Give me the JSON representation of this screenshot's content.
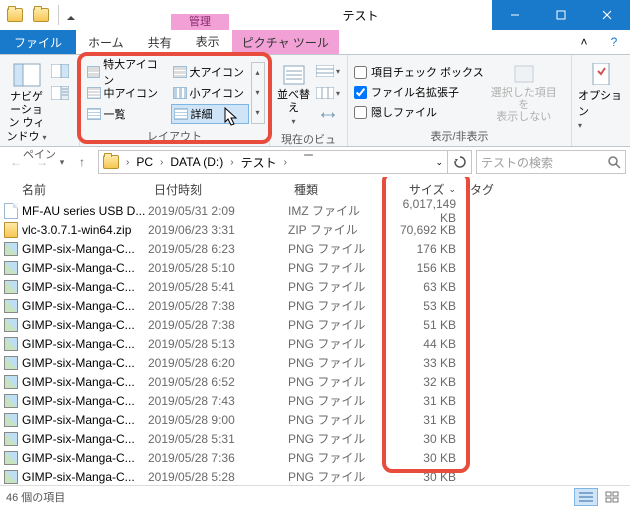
{
  "window": {
    "title": "テスト",
    "ribbon_context_label": "管理"
  },
  "tabs": {
    "file": "ファイル",
    "home": "ホーム",
    "share": "共有",
    "view": "表示",
    "picture_tools": "ピクチャ ツール"
  },
  "ribbon": {
    "pane_group": "ペイン",
    "nav_pane": "ナビゲーション ウィンドウ",
    "layout_group": "レイアウト",
    "layout": {
      "extra_large": "特大アイコン",
      "large": "大アイコン",
      "medium": "中アイコン",
      "small": "小アイコン",
      "list": "一覧",
      "details": "詳細"
    },
    "current_view_group": "現在のビュー",
    "sort": "並べ替え",
    "show_hide_group": "表示/非表示",
    "item_checkboxes": "項目チェック ボックス",
    "filename_ext": "ファイル名拡張子",
    "hidden_items": "隠しファイル",
    "hide_selected_line1": "選択した項目を",
    "hide_selected_line2": "表示しない",
    "options": "オプション"
  },
  "breadcrumb": [
    "PC",
    "DATA (D:)",
    "テスト"
  ],
  "search": {
    "placeholder": "テストの検索"
  },
  "columns": {
    "name": "名前",
    "date": "日付時刻",
    "type": "種類",
    "size": "サイズ",
    "tag": "タグ"
  },
  "files": [
    {
      "icon": "file",
      "name": "MF-AU series USB D...",
      "date": "2019/05/31 2:09",
      "type": "IMZ ファイル",
      "size": "6,017,149 KB"
    },
    {
      "icon": "zip",
      "name": "vlc-3.0.7.1-win64.zip",
      "date": "2019/06/23 3:31",
      "type": "ZIP ファイル",
      "size": "70,692 KB"
    },
    {
      "icon": "png",
      "name": "GIMP-six-Manga-C...",
      "date": "2019/05/28 6:23",
      "type": "PNG ファイル",
      "size": "176 KB"
    },
    {
      "icon": "png",
      "name": "GIMP-six-Manga-C...",
      "date": "2019/05/28 5:10",
      "type": "PNG ファイル",
      "size": "156 KB"
    },
    {
      "icon": "png",
      "name": "GIMP-six-Manga-C...",
      "date": "2019/05/28 5:41",
      "type": "PNG ファイル",
      "size": "63 KB"
    },
    {
      "icon": "png",
      "name": "GIMP-six-Manga-C...",
      "date": "2019/05/28 7:38",
      "type": "PNG ファイル",
      "size": "53 KB"
    },
    {
      "icon": "png",
      "name": "GIMP-six-Manga-C...",
      "date": "2019/05/28 7:38",
      "type": "PNG ファイル",
      "size": "51 KB"
    },
    {
      "icon": "png",
      "name": "GIMP-six-Manga-C...",
      "date": "2019/05/28 5:13",
      "type": "PNG ファイル",
      "size": "44 KB"
    },
    {
      "icon": "png",
      "name": "GIMP-six-Manga-C...",
      "date": "2019/05/28 6:20",
      "type": "PNG ファイル",
      "size": "33 KB"
    },
    {
      "icon": "png",
      "name": "GIMP-six-Manga-C...",
      "date": "2019/05/28 6:52",
      "type": "PNG ファイル",
      "size": "32 KB"
    },
    {
      "icon": "png",
      "name": "GIMP-six-Manga-C...",
      "date": "2019/05/28 7:43",
      "type": "PNG ファイル",
      "size": "31 KB"
    },
    {
      "icon": "png",
      "name": "GIMP-six-Manga-C...",
      "date": "2019/05/28 9:00",
      "type": "PNG ファイル",
      "size": "31 KB"
    },
    {
      "icon": "png",
      "name": "GIMP-six-Manga-C...",
      "date": "2019/05/28 5:31",
      "type": "PNG ファイル",
      "size": "30 KB"
    },
    {
      "icon": "png",
      "name": "GIMP-six-Manga-C...",
      "date": "2019/05/28 7:36",
      "type": "PNG ファイル",
      "size": "30 KB"
    },
    {
      "icon": "png",
      "name": "GIMP-six-Manga-C...",
      "date": "2019/05/28 5:28",
      "type": "PNG ファイル",
      "size": "30 KB"
    }
  ],
  "status": {
    "count": "46 個の項目"
  }
}
